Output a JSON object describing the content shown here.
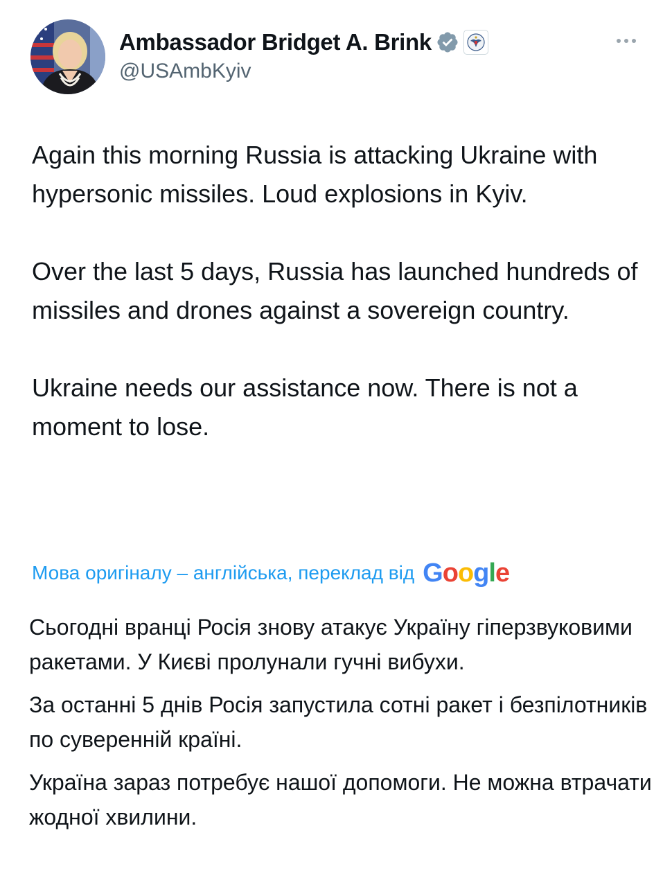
{
  "author": {
    "display_name": "Ambassador Bridget A. Brink",
    "handle": "@USAmbKyiv",
    "avatar_icon": "profile-photo",
    "verified_icon": "verified-badge-icon",
    "affiliation_icon": "us-state-department-seal-icon"
  },
  "menu": {
    "icon": "more-options-icon"
  },
  "tweet": {
    "paragraphs": [
      "Again this morning Russia is attacking Ukraine with hypersonic missiles.  Loud explosions in Kyiv.",
      "Over the last 5 days, Russia has launched hundreds of missiles and drones against a sovereign country.",
      "Ukraine needs our assistance now.  There is not a moment to lose."
    ]
  },
  "translation": {
    "label": "Мова оригіналу – англійська, переклад від",
    "provider": "Google",
    "paragraphs": [
      "Сьогодні вранці Росія знову атакує Україну гіперзвуковими ракетами. У Києві пролунали гучні вибухи.",
      "За останні 5 днів Росія запустила сотні ракет і безпілотників по суверенній країні.",
      "Україна зараз потребує нашої допомоги. Не можна втрачати жодної хвилини."
    ]
  },
  "colors": {
    "link_blue": "#1d9bf0",
    "secondary_text": "#536471",
    "google_blue": "#4285F4",
    "google_red": "#EA4335",
    "google_yellow": "#FBBC05",
    "google_green": "#34A853"
  }
}
